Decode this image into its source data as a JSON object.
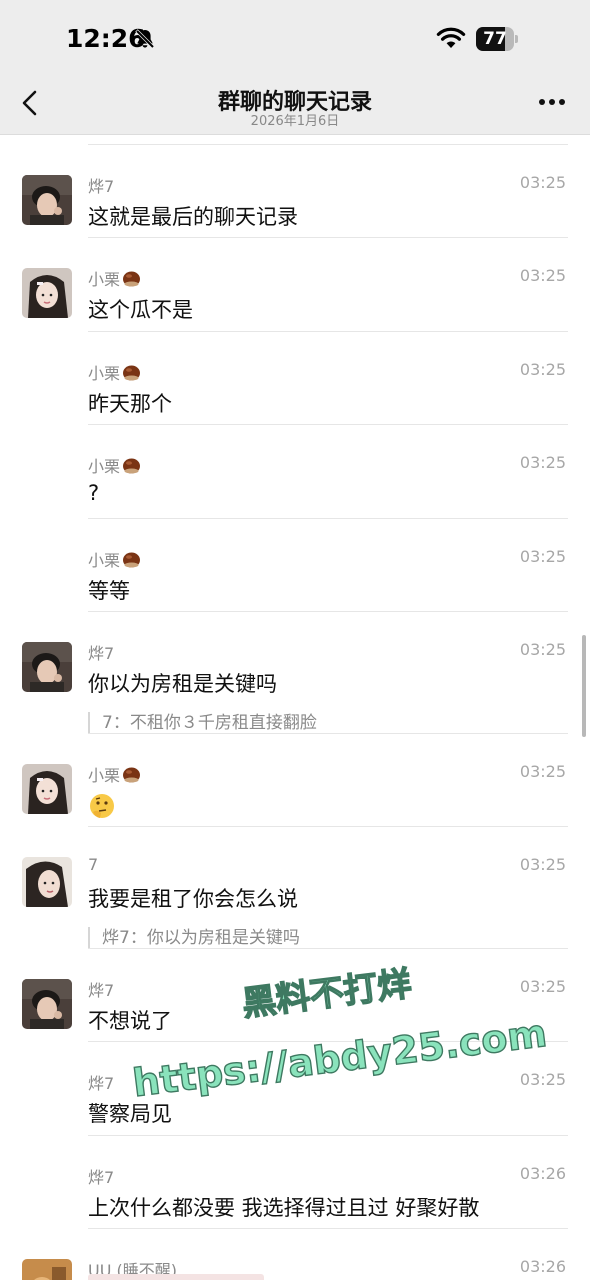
{
  "status": {
    "time": "12:26",
    "battery": "77",
    "battery_level": 0.77
  },
  "header": {
    "title": "群聊的聊天记录",
    "subtitle": "2026年1月6日"
  },
  "watermark": {
    "line1": "黑料不打烊",
    "line2": "https://abdy25.com"
  },
  "icons": {
    "back": "chevron-left-icon",
    "more": "more-dots-icon",
    "bell": "bell-slash-icon",
    "wifi": "wifi-icon",
    "chestnut": "chestnut-emoji",
    "thinking": "thinking-face-emoji"
  },
  "colors": {
    "watermark_fill": "#7ee0b5",
    "watermark_stroke": "#2a6b50",
    "header_bg": "#ededed"
  },
  "messages": [
    {
      "name": "烨7",
      "time": "03:25",
      "text": "这就是最后的聊天记录"
    },
    {
      "name": "小栗",
      "time": "03:25",
      "text": "这个瓜不是"
    },
    {
      "name": "小栗",
      "time": "03:25",
      "text": "昨天那个"
    },
    {
      "name": "小栗",
      "time": "03:25",
      "text": "?"
    },
    {
      "name": "小栗",
      "time": "03:25",
      "text": "等等"
    },
    {
      "name": "烨7",
      "time": "03:25",
      "text": "你以为房租是关键吗",
      "quote": "7：不租你３千房租直接翻脸"
    },
    {
      "name": "小栗",
      "time": "03:25",
      "text": ""
    },
    {
      "name": "7",
      "time": "03:25",
      "text": "我要是租了你会怎么说",
      "quote": "烨7：你以为房租是关键吗"
    },
    {
      "name": "烨7",
      "time": "03:25",
      "text": "不想说了"
    },
    {
      "name": "烨7",
      "time": "03:25",
      "text": "警察局见"
    },
    {
      "name": "烨7",
      "time": "03:26",
      "text": "上次什么都没要 我选择得过且过 好聚好散"
    },
    {
      "name": "UU.(睡不醒)",
      "time": "03:26",
      "text": ""
    }
  ]
}
